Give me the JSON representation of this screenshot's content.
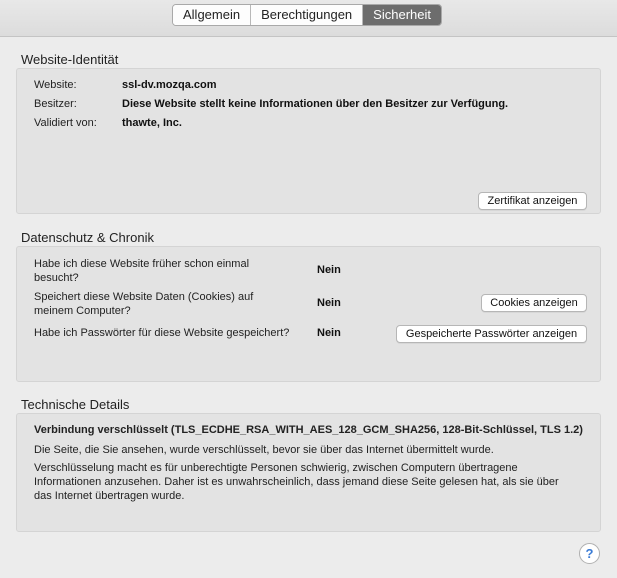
{
  "tabs": [
    "Allgemein",
    "Berechtigungen",
    "Sicherheit"
  ],
  "identity": {
    "title": "Website-Identität",
    "website_label": "Website:",
    "website_value": "ssl-dv.mozqa.com",
    "owner_label": "Besitzer:",
    "owner_value": "Diese Website stellt keine Informationen über den Besitzer zur Verfügung.",
    "validated_label": "Validiert von:",
    "validated_value": "thawte, Inc.",
    "cert_button": "Zertifikat anzeigen"
  },
  "privacy": {
    "title": "Datenschutz & Chronik",
    "q1_line1": "Habe ich diese Website früher schon einmal",
    "q1_line2": "besucht?",
    "q1_answer": "Nein",
    "q2_line1": "Speichert diese Website Daten (Cookies) auf",
    "q2_line2": "meinem Computer?",
    "q2_answer": "Nein",
    "cookies_button": "Cookies anzeigen",
    "q3": "Habe ich Passwörter für diese Website gespeichert?",
    "q3_answer": "Nein",
    "passwords_button": "Gespeicherte Passwörter anzeigen"
  },
  "technical": {
    "title": "Technische Details",
    "heading": "Verbindung verschlüsselt (TLS_ECDHE_RSA_WITH_AES_128_GCM_SHA256, 128-Bit-Schlüssel, TLS 1.2)",
    "p1": "Die Seite, die Sie ansehen, wurde verschlüsselt, bevor sie über das Internet übermittelt wurde.",
    "p2_line1": "Verschlüsselung macht es für unberechtigte Personen schwierig, zwischen Computern übertragene",
    "p2_line2": "Informationen anzusehen. Daher ist es unwahrscheinlich, dass jemand diese Seite gelesen hat, als sie über",
    "p2_line3": "das Internet übertragen wurde."
  },
  "help": {
    "symbol": "?"
  }
}
